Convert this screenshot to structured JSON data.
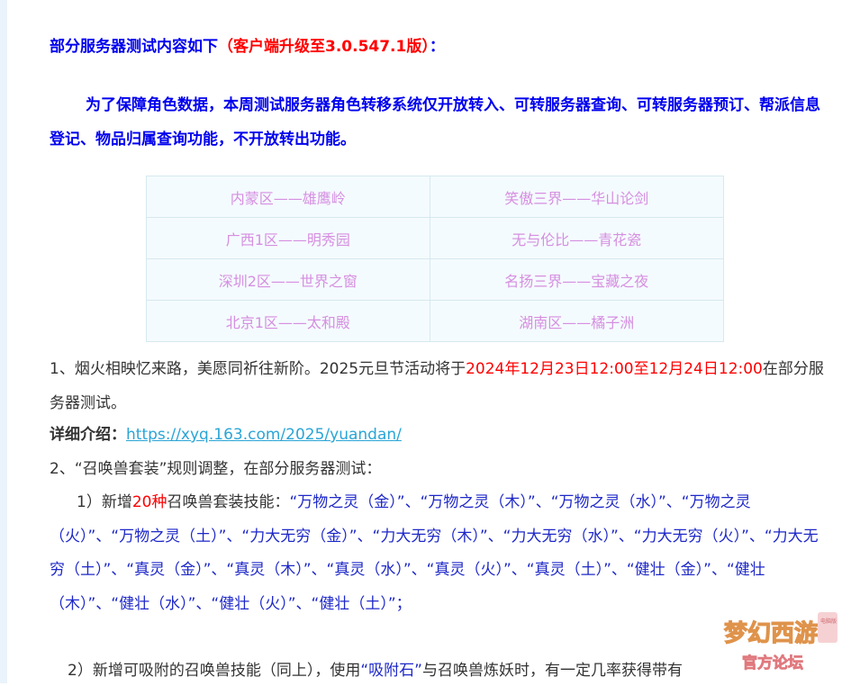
{
  "heading": {
    "prefix": "部分服务器测试内容如下",
    "highlight": "（客户端升级至3.0.547.1版）",
    "suffix": "："
  },
  "intro": "为了保障角色数据，本周测试服务器角色转移系统仅开放转入、可转服务器查询、可转服务器预订、帮派信息登记、物品归属查询功能，不开放转出功能。",
  "servers": [
    [
      "内蒙区——雄鹰岭",
      "笑傲三界——华山论剑"
    ],
    [
      "广西1区——明秀园",
      "无与伦比——青花瓷"
    ],
    [
      "深圳2区——世界之窗",
      "名扬三界——宝藏之夜"
    ],
    [
      "北京1区——太和殿",
      "湖南区——橘子洲"
    ]
  ],
  "item1": {
    "text": "1、烟火相映忆来路，美愿同祈往新阶。2025元旦节活动将于",
    "date": "2024年12月23日12:00至12月24日12:00",
    "tail": "在部分服务器测试。"
  },
  "detail": {
    "label": "详细介绍：",
    "link": "https://xyq.163.com/2025/yuandan/"
  },
  "item2": {
    "text": "2、“召唤兽套装”规则调整，在部分服务器测试："
  },
  "sub1": {
    "lead": "1）新增",
    "count": "20种",
    "after": "召唤兽套装技能：",
    "skills": "“万物之灵（金）”、“万物之灵（木）”、“万物之灵（水）”、“万物之灵（火）”、“万物之灵（土）”、“力大无穷（金）”、“力大无穷（木）”、“力大无穷（水）”、“力大无穷（火）”、“力大无穷（土）”、“真灵（金）”、“真灵（木）”、“真灵（水）”、“真灵（火）”、“真灵（土）”、“健壮（金）”、“健壮（木）”、“健壮（水）”、“健壮（火）”、“健壮（土）”；"
  },
  "sub2": {
    "lead": "2）新增可吸附的召唤兽技能（同上），使用",
    "item": "“吸附石”",
    "tail": "与召唤兽炼妖时，有一定几率获得带有"
  },
  "logo": {
    "line1": "梦幻西游",
    "line2": "官方论坛",
    "badge": "电脑版"
  },
  "colors": {
    "heading": "#0000ee",
    "highlight": "#ff0000",
    "table_text": "#d68fe0",
    "link": "#2aa5d6"
  }
}
